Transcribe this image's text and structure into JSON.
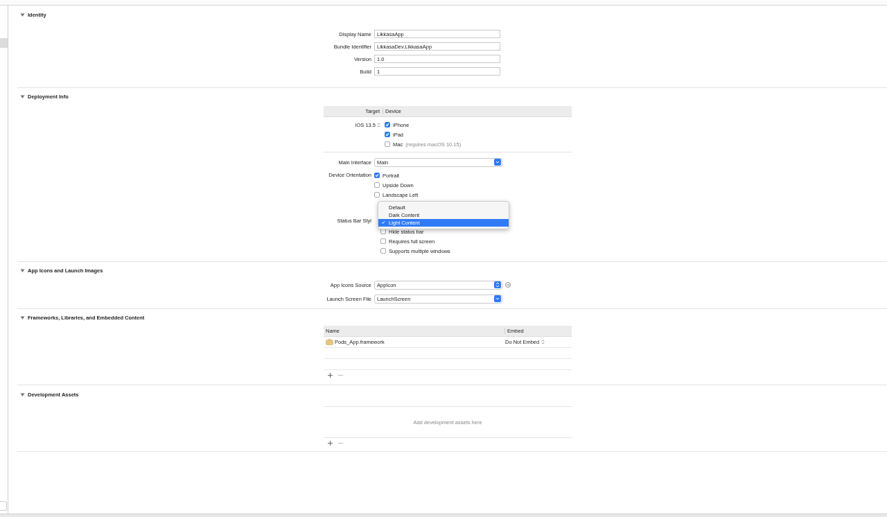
{
  "identity": {
    "title": "Identity",
    "expanded": true,
    "fields": [
      {
        "label": "Display Name",
        "value": "LikkasaApp"
      },
      {
        "label": "Bundle Identifier",
        "value": "LikkasaDev.LikkasaApp"
      },
      {
        "label": "Version",
        "value": "1.0"
      },
      {
        "label": "Build",
        "value": "1"
      }
    ]
  },
  "deployment": {
    "title": "Deployment Info",
    "expanded": true,
    "table": {
      "columns": [
        "Target",
        "Device"
      ],
      "target": "iOS 13.5",
      "devices": [
        {
          "label": "iPhone",
          "checked": true
        },
        {
          "label": "iPad",
          "checked": true
        },
        {
          "label": "Mac",
          "note": "(requires macOS 10.15)",
          "checked": false
        }
      ]
    },
    "main_interface": {
      "label": "Main Interface",
      "value": "Main",
      "kind": "combo"
    },
    "orientation": {
      "label": "Device Orientation",
      "options": [
        {
          "label": "Portrait",
          "checked": true
        },
        {
          "label": "Upside Down",
          "checked": false
        },
        {
          "label": "Landscape Left",
          "checked": false
        }
      ]
    },
    "status_bar": {
      "label": "Status Bar Styl",
      "menu": [
        {
          "label": "Default",
          "selected": false
        },
        {
          "label": "Dark Content",
          "selected": false
        },
        {
          "label": "Light Content",
          "selected": true
        }
      ],
      "options": [
        {
          "label": "Hide status bar",
          "checked": false
        },
        {
          "label": "Requires full screen",
          "checked": false
        },
        {
          "label": "Supports multiple windows",
          "checked": false
        }
      ]
    }
  },
  "app_icons": {
    "title": "App Icons and Launch Images",
    "expanded": true,
    "fields": [
      {
        "label": "App Icons Source",
        "value": "AppIcon",
        "kind": "popup"
      },
      {
        "label": "Launch Screen File",
        "value": "LaunchScreen",
        "kind": "combo"
      }
    ]
  },
  "frameworks": {
    "title": "Frameworks, Libraries, and Embedded Content",
    "expanded": true,
    "columns": [
      "Name",
      "Embed"
    ],
    "rows": [
      {
        "name": "Pods_App.framework",
        "embed": "Do Not Embed"
      }
    ]
  },
  "dev_assets": {
    "title": "Development Assets",
    "expanded": true,
    "placeholder": "Add development assets here"
  }
}
